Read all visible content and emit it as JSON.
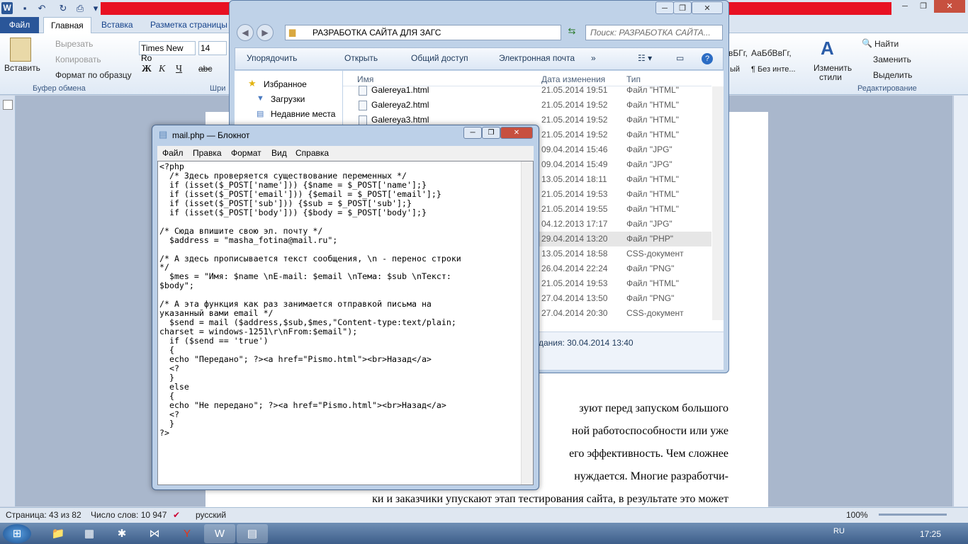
{
  "word": {
    "tabs": [
      "Файл",
      "Главная",
      "Вставка",
      "Разметка страницы"
    ],
    "clipboard": {
      "paste": "Вставить",
      "cut": "Вырезать",
      "copy": "Копировать",
      "format": "Формат по образцу",
      "group": "Буфер обмена"
    },
    "font": {
      "name": "Times New Ro",
      "size": "14",
      "group": "Шри"
    },
    "styles": {
      "s1": "вБГг,",
      "s1b": "ый",
      "s2": "АаБбВвГг,",
      "s2b": "¶ Без инте...",
      "change": "Изменить",
      "change2": "стили"
    },
    "editing": {
      "find": "Найти",
      "replace": "Заменить",
      "select": "Выделить",
      "group": "Редактирование"
    },
    "doc_lines": [
      "зуют перед запуском большого",
      "ной работоспособности или уже",
      "его эффективность. Чем сложнее",
      "нуждается. Многие разработчи-",
      "ки и заказчики упускают этап тестирования сайта, в результате это может"
    ],
    "status": {
      "page": "Страница: 43 из 82",
      "words": "Число слов: 10 947",
      "lang": "русский",
      "zoom": "100%"
    }
  },
  "explorer": {
    "path": "РАЗРАБОТКА САЙТА ДЛЯ ЗАГС",
    "search_placeholder": "Поиск: РАЗРАБОТКА САЙТА...",
    "toolbar": {
      "organize": "Упорядочить",
      "open": "Открыть",
      "share": "Общий доступ",
      "email": "Электронная почта",
      "more": "»"
    },
    "nav": [
      "Избранное",
      "Загрузки",
      "Недавние места"
    ],
    "columns": {
      "name": "Имя",
      "date": "Дата изменения",
      "type": "Тип"
    },
    "rows": [
      {
        "name": "Galereya1.html",
        "date": "21.05.2014 19:51",
        "type": "Файл \"HTML\""
      },
      {
        "name": "Galereya2.html",
        "date": "21.05.2014 19:52",
        "type": "Файл \"HTML\""
      },
      {
        "name": "Galereya3.html",
        "date": "21.05.2014 19:52",
        "type": "Файл \"HTML\""
      },
      {
        "name": "",
        "date": "21.05.2014 19:52",
        "type": "Файл \"HTML\""
      },
      {
        "name": "",
        "date": "09.04.2014 15:46",
        "type": "Файл \"JPG\""
      },
      {
        "name": "",
        "date": "09.04.2014 15:49",
        "type": "Файл \"JPG\""
      },
      {
        "name": "",
        "date": "13.05.2014 18:11",
        "type": "Файл \"HTML\""
      },
      {
        "name": "",
        "date": "21.05.2014 19:53",
        "type": "Файл \"HTML\""
      },
      {
        "name": "",
        "date": "21.05.2014 19:55",
        "type": "Файл \"HTML\""
      },
      {
        "name": "",
        "date": "04.12.2013 17:17",
        "type": "Файл \"JPG\""
      },
      {
        "name": "",
        "date": "29.04.2014 13:20",
        "type": "Файл \"PHP\""
      },
      {
        "name": "",
        "date": "13.05.2014 18:58",
        "type": "CSS-документ"
      },
      {
        "name": "",
        "date": "26.04.2014 22:24",
        "type": "Файл \"PNG\""
      },
      {
        "name": "",
        "date": "21.05.2014 19:53",
        "type": "Файл \"HTML\""
      },
      {
        "name": "",
        "date": "27.04.2014 13:50",
        "type": "Файл \"PNG\""
      },
      {
        "name": "",
        "date": "27.04.2014 20:30",
        "type": "CSS-документ"
      }
    ],
    "details": "дания:  30.04.2014 13:40"
  },
  "notepad": {
    "title": "mail.php — Блокнот",
    "menu": [
      "Файл",
      "Правка",
      "Формат",
      "Вид",
      "Справка"
    ],
    "text": "<?php\n  /* Здесь проверяется существование переменных */\n  if (isset($_POST['name'])) {$name = $_POST['name'];}\n  if (isset($_POST['email'])) {$email = $_POST['email'];}\n  if (isset($_POST['sub'])) {$sub = $_POST['sub'];}\n  if (isset($_POST['body'])) {$body = $_POST['body'];}\n\n/* Сюда впишите свою эл. почту */\n  $address = \"masha_fotina@mail.ru\";\n\n/* А здесь прописывается текст сообщения, \\n - перенос строки\n*/\n  $mes = \"Имя: $name \\nE-mail: $email \\nТема: $sub \\nТекст:\n$body\";\n\n/* А эта функция как раз занимается отправкой письма на\nуказанный вами email */\n  $send = mail ($address,$sub,$mes,\"Content-type:text/plain;\ncharset = windows-1251\\r\\nFrom:$email\");\n  if ($send == 'true')\n  {\n  echo \"Передано\"; ?><a href=\"Pismo.html\"><br>Назад</a>\n  <?\n  }\n  else\n  {\n  echo \"Не передано\"; ?><a href=\"Pismo.html\"><br>Назад</a>\n  <?\n  }\n?>"
  },
  "taskbar": {
    "lang": "RU",
    "time": "17:25"
  }
}
